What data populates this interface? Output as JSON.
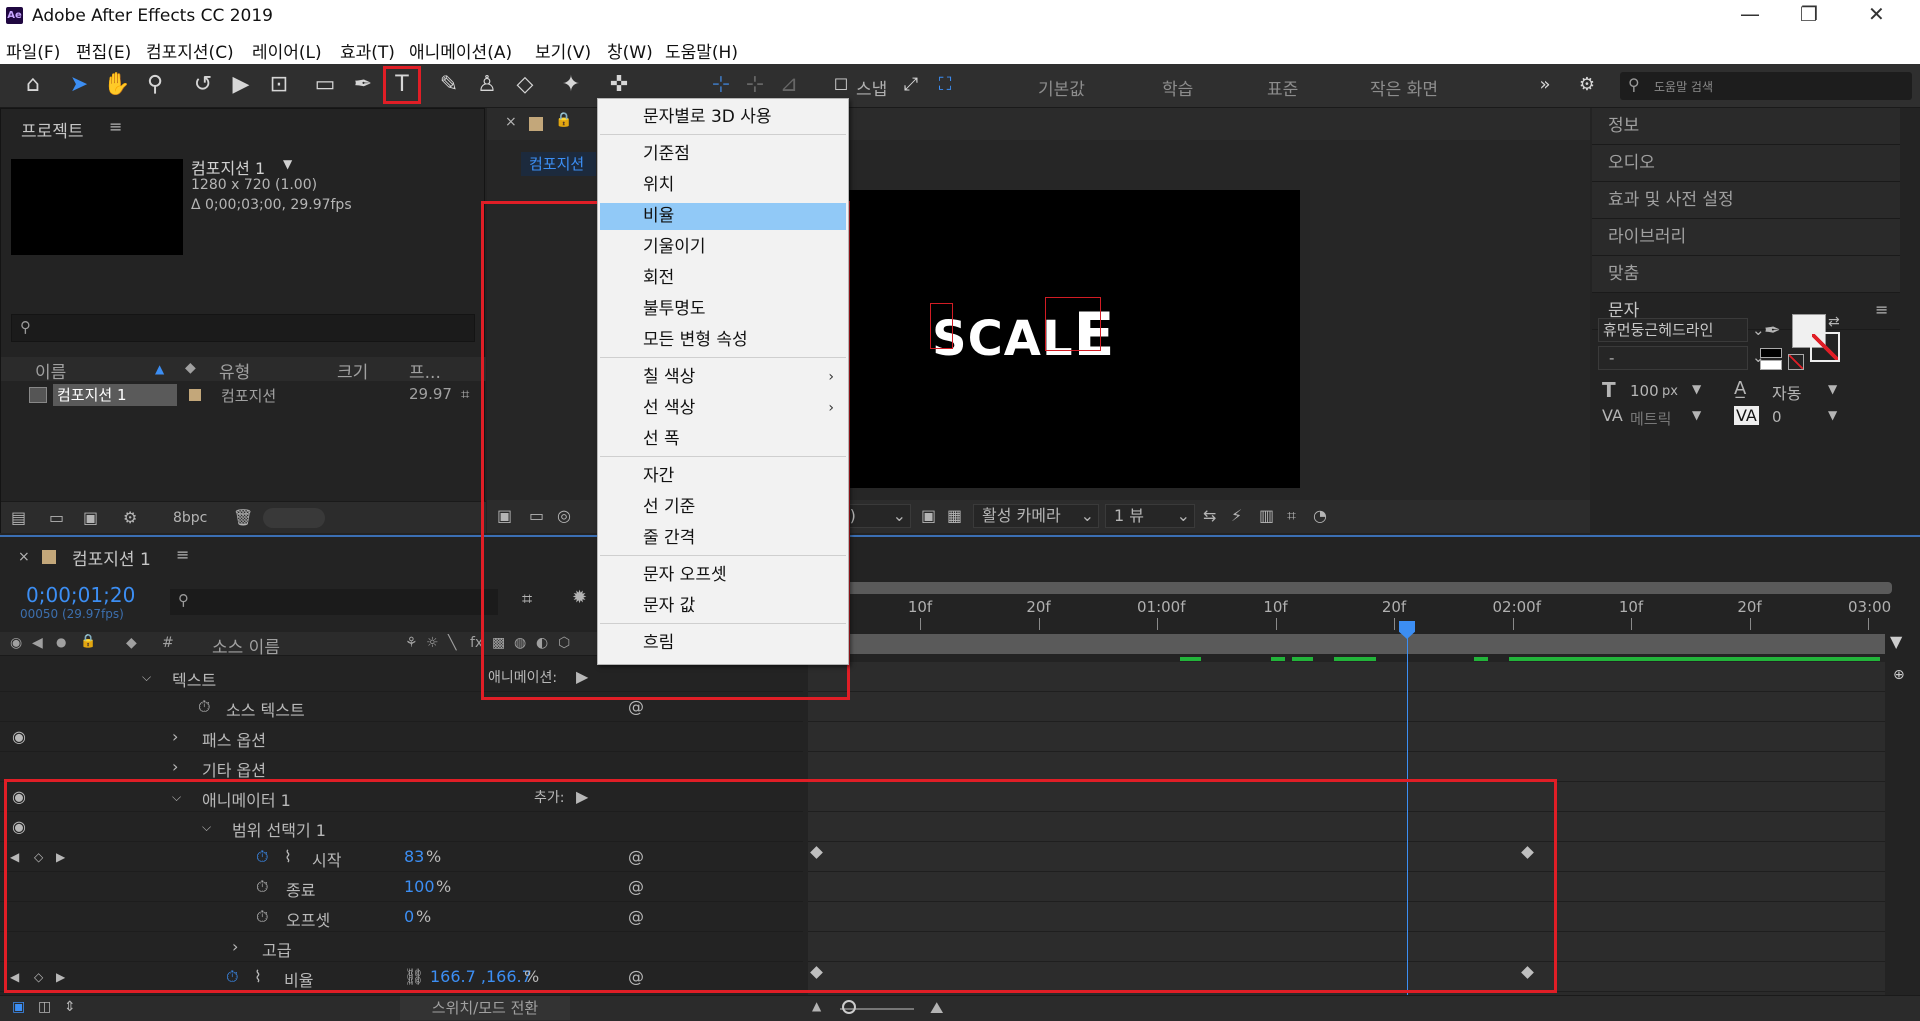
{
  "app": {
    "title": "Adobe After Effects CC 2019",
    "logo": "Ae",
    "window_controls": [
      "—",
      "❐",
      "✕"
    ]
  },
  "menubar": [
    "파일(F)",
    "편집(E)",
    "컴포지션(C)",
    "레이어(L)",
    "효과(T)",
    "애니메이션(A)",
    "보기(V)",
    "창(W)",
    "도움말(H)"
  ],
  "toolbar": {
    "snap_label": "스냅",
    "workspaces": [
      "기본값",
      "학습",
      "표준",
      "작은 화면"
    ],
    "help_search_placeholder": "도움말 검색"
  },
  "project": {
    "header": "프로젝트",
    "comp_name": "컴포지션 1",
    "comp_size": "1280 x 720 (1.00)",
    "comp_duration": "Δ 0;00;03;00, 29.97fps",
    "columns": [
      "이름",
      "유형",
      "크기",
      "프..."
    ],
    "row": {
      "name": "컴포지션 1",
      "type": "컴포지션",
      "fps": "29.97"
    },
    "bpc": "8bpc"
  },
  "viewer": {
    "subtab": "컴포지션",
    "canvas_text_main": "SCAL",
    "canvas_text_last": "E",
    "resolution": "(절반)",
    "camera": "활성 카메라",
    "views": "1 뷰"
  },
  "right_panel": {
    "tabs": [
      "정보",
      "오디오",
      "효과 및 사전 설정",
      "라이브러리",
      "맞춤",
      "문자"
    ],
    "font": "휴먼둥근헤드라인",
    "font_style": "-",
    "font_size": "100",
    "font_size_unit": "px",
    "leading": "자동",
    "kerning": "메트릭",
    "tracking": "0"
  },
  "timeline": {
    "tab": "컴포지션 1",
    "timecode": "0;00;01;20",
    "frame_info": "00050 (29.97fps)",
    "source_name_col": "소스 이름",
    "ruler_labels": [
      "10f",
      "20f",
      "01:00f",
      "10f",
      "20f",
      "02:00f",
      "10f",
      "20f",
      "03:00"
    ],
    "layers": [
      {
        "label": "텍스트",
        "extra": "애니메이션:"
      },
      {
        "label": "소스 텍스트"
      },
      {
        "label": "패스 옵션"
      },
      {
        "label": "기타 옵션"
      },
      {
        "label": "애니메이터 1",
        "extra": "추가:"
      },
      {
        "label": "범위 선택기 1"
      },
      {
        "label": "시작",
        "value": "83",
        "unit": "%"
      },
      {
        "label": "종료",
        "value": "100",
        "unit": "%"
      },
      {
        "label": "오프셋",
        "value": "0",
        "unit": "%"
      },
      {
        "label": "고급"
      },
      {
        "label": "비율",
        "value": "166.7 ,166.7",
        "unit": "%"
      }
    ],
    "footer_label": "스위치/모드 전환"
  },
  "context_menu": {
    "items": [
      {
        "label": "문자별로 3D 사용"
      },
      {
        "label": "기준점"
      },
      {
        "label": "위치"
      },
      {
        "label": "비율",
        "active": true
      },
      {
        "label": "기울이기"
      },
      {
        "label": "회전"
      },
      {
        "label": "불투명도"
      },
      {
        "label": "모든 변형 속성"
      },
      {
        "label": "칠 색상",
        "submenu": true
      },
      {
        "label": "선 색상",
        "submenu": true
      },
      {
        "label": "선 폭"
      },
      {
        "label": "자간"
      },
      {
        "label": "선 기준"
      },
      {
        "label": "줄 간격"
      },
      {
        "label": "문자 오프셋"
      },
      {
        "label": "문자 값"
      },
      {
        "label": "흐림"
      }
    ]
  },
  "colors": {
    "accent": "#3c8ef3",
    "highlight_red": "#e01e26",
    "menu_active": "#91c9f7",
    "panel_bg": "#232323"
  }
}
